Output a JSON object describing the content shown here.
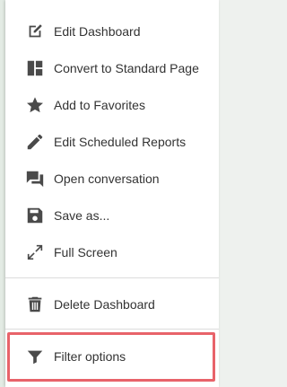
{
  "menu": {
    "items": [
      {
        "label": "Edit Dashboard",
        "icon": "edit-square-icon"
      },
      {
        "label": "Convert to Standard Page",
        "icon": "layout-blocks-icon"
      },
      {
        "label": "Add to Favorites",
        "icon": "star-icon"
      },
      {
        "label": "Edit Scheduled Reports",
        "icon": "pencil-icon"
      },
      {
        "label": "Open conversation",
        "icon": "chat-icon"
      },
      {
        "label": "Save as...",
        "icon": "save-icon"
      },
      {
        "label": "Full Screen",
        "icon": "expand-icon"
      },
      {
        "label": "Delete Dashboard",
        "icon": "trash-icon"
      },
      {
        "label": "Filter options",
        "icon": "filter-icon"
      }
    ]
  },
  "colors": {
    "highlight_border": "#e8636a",
    "icon": "#4a4a4a",
    "text": "#333333"
  }
}
